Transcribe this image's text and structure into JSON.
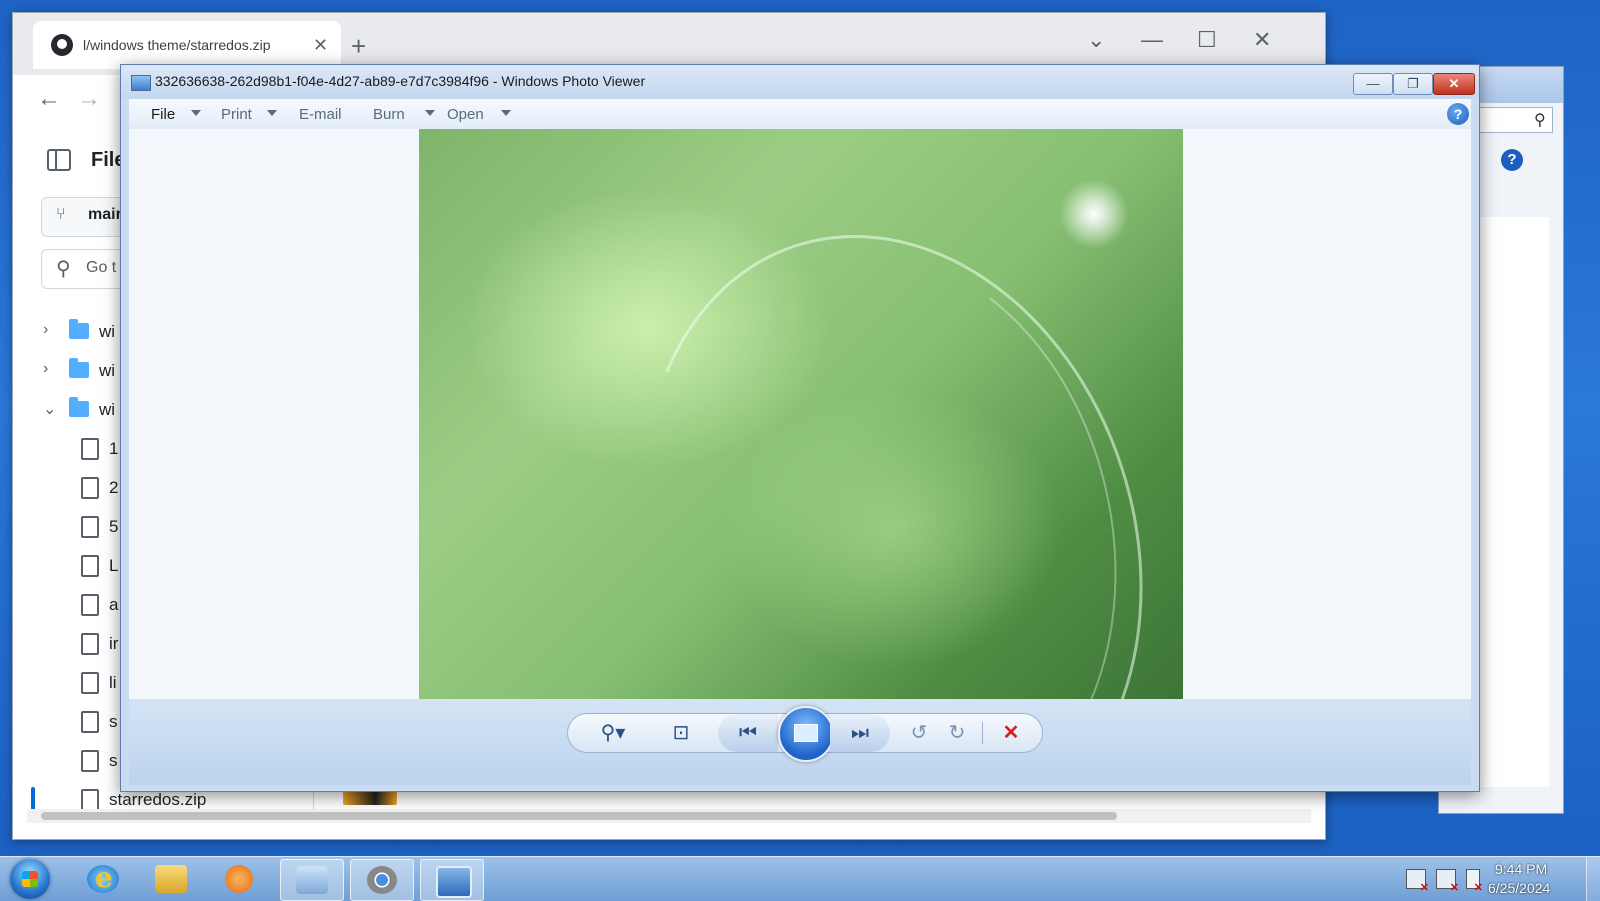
{
  "browser": {
    "tab_title": "l/windows theme/starredos.zip",
    "new_tab": "+",
    "close_tab": "✕",
    "controls": {
      "collapse": "⌄",
      "minimize": "—",
      "maximize": "☐",
      "close": "✕"
    },
    "nav": {
      "back": "←",
      "forward": "→"
    }
  },
  "github": {
    "files_title": "File",
    "branch": "mair",
    "search_placeholder": "Go t",
    "tree": [
      {
        "type": "folder",
        "expanded": false,
        "name": "wi"
      },
      {
        "type": "folder",
        "expanded": false,
        "name": "wi"
      },
      {
        "type": "folder",
        "expanded": true,
        "name": "wi"
      },
      {
        "type": "file",
        "name": "1"
      },
      {
        "type": "file",
        "name": "2"
      },
      {
        "type": "file",
        "name": "5"
      },
      {
        "type": "file",
        "name": "L"
      },
      {
        "type": "file",
        "name": "a"
      },
      {
        "type": "file",
        "name": "ir"
      },
      {
        "type": "file",
        "name": "li"
      },
      {
        "type": "file",
        "name": "s"
      },
      {
        "type": "file",
        "name": "s"
      },
      {
        "type": "file",
        "name": "starredos.zip",
        "active": true
      }
    ]
  },
  "explorer": {
    "help": "?",
    "search_icon": "search-icon"
  },
  "photo_viewer": {
    "title": "332636638-262d98b1-f04e-4d27-ab89-e7d7c3984f96 - Windows Photo Viewer",
    "menu": [
      "File",
      "Print",
      "E-mail",
      "Burn",
      "Open"
    ],
    "help": "?",
    "window_controls": {
      "minimize": "—",
      "restore": "❐",
      "close": "✕"
    },
    "toolbar_icons": {
      "zoom": "⚲▾",
      "actual_size": "⊡",
      "previous": "⏮",
      "next": "⏭",
      "rotate_ccw": "↺",
      "rotate_cw": "↻",
      "delete": "✕"
    }
  },
  "taskbar": {
    "apps": [
      "internet-explorer",
      "windows-explorer",
      "media-player",
      "remote-desktop",
      "chrome",
      "photo-viewer"
    ],
    "time": "9:44 PM",
    "date": "6/25/2024"
  },
  "colors": {
    "desktop_blue": "#1f63c4",
    "photo_viewer_frame": "#c9dcf1",
    "github_folder": "#54aeff",
    "delete_red": "#d0211c"
  }
}
